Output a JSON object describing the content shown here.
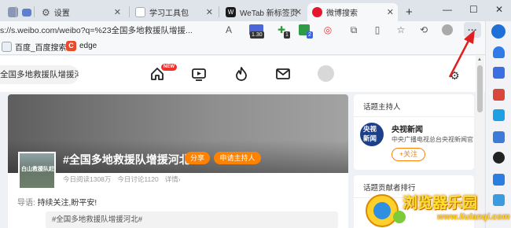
{
  "tabs": [
    {
      "label": "",
      "icon": "page-icon"
    },
    {
      "label": "设置",
      "icon": "gear-icon"
    },
    {
      "label": "学习工具包",
      "icon": "page-icon"
    },
    {
      "label": "WeTab 新标签页",
      "icon": "wetab-icon"
    },
    {
      "label": "微博搜索",
      "icon": "weibo-icon",
      "active": true
    }
  ],
  "new_tab_label": "+",
  "window": {
    "minimize": "—",
    "maximize": "☐",
    "close": "✕"
  },
  "address": {
    "url": "s://s.weibo.com/weibo?q=%23全国多地救援队增援..."
  },
  "extensions": {
    "badge_1": "1.30",
    "badge_2": "1",
    "badge_3": "2"
  },
  "bookmarks": [
    {
      "label": "百度_百度搜索",
      "icon": "bookmark-page-icon"
    },
    {
      "label": "edge",
      "icon": "edge-c-icon"
    }
  ],
  "weibo": {
    "search_text": "全国多地救援队增援河",
    "new_badge": "NEW",
    "topic": {
      "title": "#全国多地救援队增援河北#",
      "share_label": "分享",
      "apply_host_label": "申请主持人",
      "reads": "今日阅读1308万",
      "discussions": "今日讨论1120",
      "details": "详情›",
      "thumb_caption": "白山救援队赶赴",
      "intro_label": "导语:",
      "intro_text": "持续关注,盼平安!",
      "quote": "#全国多地救援队增援河北#"
    },
    "host_card": {
      "heading": "话题主持人",
      "logo_line1": "央视",
      "logo_line2": "新闻",
      "name": "央视新闻",
      "description": "中央广播电视总台央视新闻官",
      "follow_label": "+关注"
    },
    "contributors_heading": "话题贡献者排行"
  },
  "watermark": {
    "text": "浏览器乐园",
    "sub": "www.liulanqi.com"
  },
  "colors": {
    "accent_orange": "#ff8200",
    "arrow_red": "#e02020",
    "weibo_red": "#e6162d"
  }
}
